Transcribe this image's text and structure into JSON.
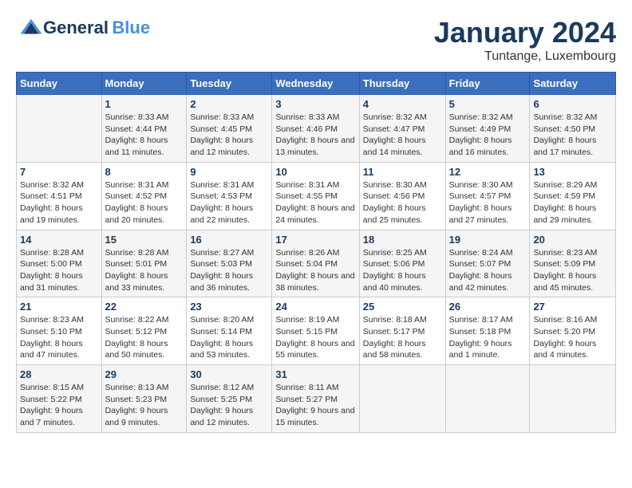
{
  "logo": {
    "general": "General",
    "blue": "Blue"
  },
  "title": {
    "month": "January 2024",
    "location": "Tuntange, Luxembourg"
  },
  "days_of_week": [
    "Sunday",
    "Monday",
    "Tuesday",
    "Wednesday",
    "Thursday",
    "Friday",
    "Saturday"
  ],
  "weeks": [
    [
      {
        "day": "",
        "sunrise": "",
        "sunset": "",
        "daylight": ""
      },
      {
        "day": "1",
        "sunrise": "Sunrise: 8:33 AM",
        "sunset": "Sunset: 4:44 PM",
        "daylight": "Daylight: 8 hours and 11 minutes."
      },
      {
        "day": "2",
        "sunrise": "Sunrise: 8:33 AM",
        "sunset": "Sunset: 4:45 PM",
        "daylight": "Daylight: 8 hours and 12 minutes."
      },
      {
        "day": "3",
        "sunrise": "Sunrise: 8:33 AM",
        "sunset": "Sunset: 4:46 PM",
        "daylight": "Daylight: 8 hours and 13 minutes."
      },
      {
        "day": "4",
        "sunrise": "Sunrise: 8:32 AM",
        "sunset": "Sunset: 4:47 PM",
        "daylight": "Daylight: 8 hours and 14 minutes."
      },
      {
        "day": "5",
        "sunrise": "Sunrise: 8:32 AM",
        "sunset": "Sunset: 4:49 PM",
        "daylight": "Daylight: 8 hours and 16 minutes."
      },
      {
        "day": "6",
        "sunrise": "Sunrise: 8:32 AM",
        "sunset": "Sunset: 4:50 PM",
        "daylight": "Daylight: 8 hours and 17 minutes."
      }
    ],
    [
      {
        "day": "7",
        "sunrise": "Sunrise: 8:32 AM",
        "sunset": "Sunset: 4:51 PM",
        "daylight": "Daylight: 8 hours and 19 minutes."
      },
      {
        "day": "8",
        "sunrise": "Sunrise: 8:31 AM",
        "sunset": "Sunset: 4:52 PM",
        "daylight": "Daylight: 8 hours and 20 minutes."
      },
      {
        "day": "9",
        "sunrise": "Sunrise: 8:31 AM",
        "sunset": "Sunset: 4:53 PM",
        "daylight": "Daylight: 8 hours and 22 minutes."
      },
      {
        "day": "10",
        "sunrise": "Sunrise: 8:31 AM",
        "sunset": "Sunset: 4:55 PM",
        "daylight": "Daylight: 8 hours and 24 minutes."
      },
      {
        "day": "11",
        "sunrise": "Sunrise: 8:30 AM",
        "sunset": "Sunset: 4:56 PM",
        "daylight": "Daylight: 8 hours and 25 minutes."
      },
      {
        "day": "12",
        "sunrise": "Sunrise: 8:30 AM",
        "sunset": "Sunset: 4:57 PM",
        "daylight": "Daylight: 8 hours and 27 minutes."
      },
      {
        "day": "13",
        "sunrise": "Sunrise: 8:29 AM",
        "sunset": "Sunset: 4:59 PM",
        "daylight": "Daylight: 8 hours and 29 minutes."
      }
    ],
    [
      {
        "day": "14",
        "sunrise": "Sunrise: 8:28 AM",
        "sunset": "Sunset: 5:00 PM",
        "daylight": "Daylight: 8 hours and 31 minutes."
      },
      {
        "day": "15",
        "sunrise": "Sunrise: 8:28 AM",
        "sunset": "Sunset: 5:01 PM",
        "daylight": "Daylight: 8 hours and 33 minutes."
      },
      {
        "day": "16",
        "sunrise": "Sunrise: 8:27 AM",
        "sunset": "Sunset: 5:03 PM",
        "daylight": "Daylight: 8 hours and 36 minutes."
      },
      {
        "day": "17",
        "sunrise": "Sunrise: 8:26 AM",
        "sunset": "Sunset: 5:04 PM",
        "daylight": "Daylight: 8 hours and 38 minutes."
      },
      {
        "day": "18",
        "sunrise": "Sunrise: 8:25 AM",
        "sunset": "Sunset: 5:06 PM",
        "daylight": "Daylight: 8 hours and 40 minutes."
      },
      {
        "day": "19",
        "sunrise": "Sunrise: 8:24 AM",
        "sunset": "Sunset: 5:07 PM",
        "daylight": "Daylight: 8 hours and 42 minutes."
      },
      {
        "day": "20",
        "sunrise": "Sunrise: 8:23 AM",
        "sunset": "Sunset: 5:09 PM",
        "daylight": "Daylight: 8 hours and 45 minutes."
      }
    ],
    [
      {
        "day": "21",
        "sunrise": "Sunrise: 8:23 AM",
        "sunset": "Sunset: 5:10 PM",
        "daylight": "Daylight: 8 hours and 47 minutes."
      },
      {
        "day": "22",
        "sunrise": "Sunrise: 8:22 AM",
        "sunset": "Sunset: 5:12 PM",
        "daylight": "Daylight: 8 hours and 50 minutes."
      },
      {
        "day": "23",
        "sunrise": "Sunrise: 8:20 AM",
        "sunset": "Sunset: 5:14 PM",
        "daylight": "Daylight: 8 hours and 53 minutes."
      },
      {
        "day": "24",
        "sunrise": "Sunrise: 8:19 AM",
        "sunset": "Sunset: 5:15 PM",
        "daylight": "Daylight: 8 hours and 55 minutes."
      },
      {
        "day": "25",
        "sunrise": "Sunrise: 8:18 AM",
        "sunset": "Sunset: 5:17 PM",
        "daylight": "Daylight: 8 hours and 58 minutes."
      },
      {
        "day": "26",
        "sunrise": "Sunrise: 8:17 AM",
        "sunset": "Sunset: 5:18 PM",
        "daylight": "Daylight: 9 hours and 1 minute."
      },
      {
        "day": "27",
        "sunrise": "Sunrise: 8:16 AM",
        "sunset": "Sunset: 5:20 PM",
        "daylight": "Daylight: 9 hours and 4 minutes."
      }
    ],
    [
      {
        "day": "28",
        "sunrise": "Sunrise: 8:15 AM",
        "sunset": "Sunset: 5:22 PM",
        "daylight": "Daylight: 9 hours and 7 minutes."
      },
      {
        "day": "29",
        "sunrise": "Sunrise: 8:13 AM",
        "sunset": "Sunset: 5:23 PM",
        "daylight": "Daylight: 9 hours and 9 minutes."
      },
      {
        "day": "30",
        "sunrise": "Sunrise: 8:12 AM",
        "sunset": "Sunset: 5:25 PM",
        "daylight": "Daylight: 9 hours and 12 minutes."
      },
      {
        "day": "31",
        "sunrise": "Sunrise: 8:11 AM",
        "sunset": "Sunset: 5:27 PM",
        "daylight": "Daylight: 9 hours and 15 minutes."
      },
      {
        "day": "",
        "sunrise": "",
        "sunset": "",
        "daylight": ""
      },
      {
        "day": "",
        "sunrise": "",
        "sunset": "",
        "daylight": ""
      },
      {
        "day": "",
        "sunrise": "",
        "sunset": "",
        "daylight": ""
      }
    ]
  ]
}
